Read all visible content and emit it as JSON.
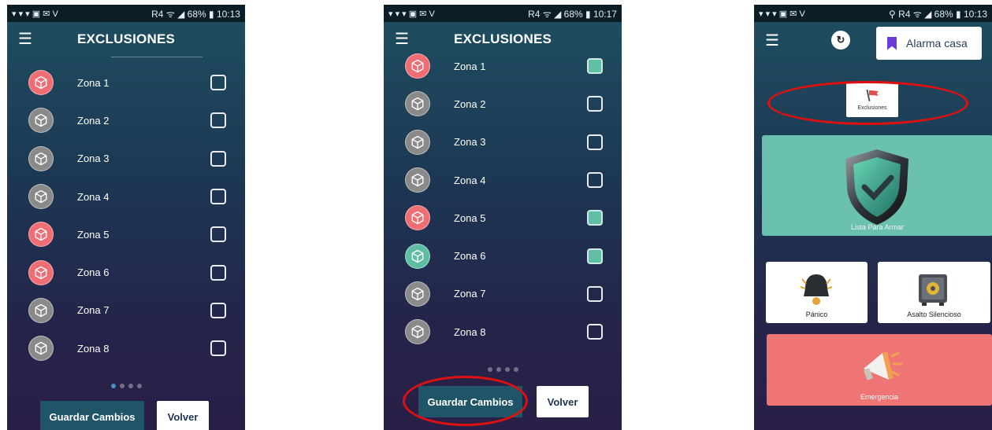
{
  "status_bar": {
    "p1": {
      "left": "▾ ▾ ▾ ▣ ✉ V",
      "right": "R4 ᯤ ◢ 68% ▮ 10:13"
    },
    "p2": {
      "left": "▾ ▾ ▾ ▣ ✉ V",
      "right": "R4 ᯤ ◢ 68% ▮ 10:17"
    },
    "p3": {
      "left": "▾ ▾ ▾ ▣ ✉ V",
      "right": "⚲ R4 ᯤ ◢ 68% ▮ 10:13"
    }
  },
  "screen1": {
    "title": "EXCLUSIONES",
    "zones": [
      {
        "label": "Zona 1",
        "color": "red",
        "checked": false
      },
      {
        "label": "Zona 2",
        "color": "gray",
        "checked": false
      },
      {
        "label": "Zona 3",
        "color": "gray",
        "checked": false
      },
      {
        "label": "Zona 4",
        "color": "gray",
        "checked": false
      },
      {
        "label": "Zona 5",
        "color": "red",
        "checked": false
      },
      {
        "label": "Zona 6",
        "color": "red",
        "checked": false
      },
      {
        "label": "Zona 7",
        "color": "gray",
        "checked": false
      },
      {
        "label": "Zona 8",
        "color": "gray",
        "checked": false
      }
    ],
    "save_label": "Guardar Cambios",
    "back_label": "Volver",
    "page_count": 4,
    "active_page": 1
  },
  "screen2": {
    "title": "EXCLUSIONES",
    "zones": [
      {
        "label": "Zona 1",
        "color": "red",
        "checked": true
      },
      {
        "label": "Zona 2",
        "color": "gray",
        "checked": false
      },
      {
        "label": "Zona 3",
        "color": "gray",
        "checked": false
      },
      {
        "label": "Zona 4",
        "color": "gray",
        "checked": false
      },
      {
        "label": "Zona 5",
        "color": "red",
        "checked": true
      },
      {
        "label": "Zona 6",
        "color": "green",
        "checked": true
      },
      {
        "label": "Zona 7",
        "color": "gray",
        "checked": false
      },
      {
        "label": "Zona 8",
        "color": "gray",
        "checked": false
      }
    ],
    "save_label": "Guardar Cambios",
    "back_label": "Volver",
    "page_count": 4
  },
  "screen3": {
    "alarm_name": "Alarma casa",
    "exclusions_label": "Exclusiones",
    "arm_status_label": "Lista Para Armar",
    "panic_label": "Pánico",
    "assault_label": "Asalto Silencioso",
    "emergency_label": "Emergencia"
  },
  "colors": {
    "zone_red": "#ef6e73",
    "zone_gray": "#8a8a8a",
    "zone_green": "#5dbea4",
    "teal_tile": "#69c1ae",
    "emergency_tile": "#ef7474",
    "annotation_red": "#e01010"
  }
}
